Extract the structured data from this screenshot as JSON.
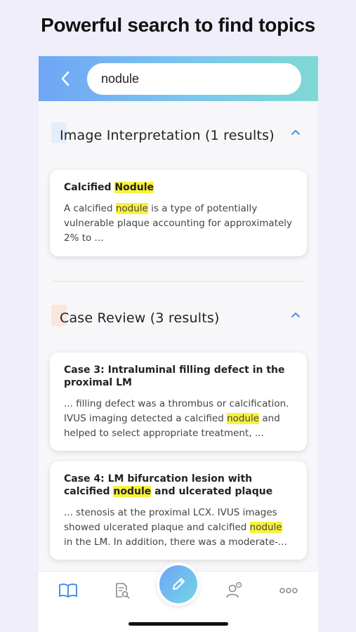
{
  "headline": "Powerful search to find topics",
  "search": {
    "value": "nodule"
  },
  "sections": [
    {
      "title": "Image Interpretation (1 results)",
      "icon": "document-icon",
      "icon_color": "#e4eefa",
      "results": [
        {
          "title_parts": [
            "Calcified ",
            "Nodule",
            ""
          ],
          "body_parts": [
            "A calcified ",
            "nodule",
            " is a type of potentially vulnerable plaque accounting for approximately 2% to ..."
          ]
        }
      ]
    },
    {
      "title": "Case Review (3 results)",
      "icon": "case-icon",
      "icon_color": "#fbe6dc",
      "results": [
        {
          "title_parts": [
            "Case 3: Intraluminal filling defect in the proximal LM",
            "",
            ""
          ],
          "body_parts": [
            "... filling defect was a thrombus or calcification. IVUS imaging detected a calcified ",
            "nodule",
            " and helped to select appropriate treatment, ..."
          ]
        },
        {
          "title_parts": [
            "Case 4: LM bifurcation lesion with calcified ",
            "nodule",
            " and ulcerated plaque"
          ],
          "body_parts": [
            "... stenosis at the proximal LCX. IVUS images showed ulcerated plaque and calcified ",
            "nodule",
            " in the LM. In addition, there was a moderate-..."
          ]
        }
      ]
    }
  ],
  "tabbar": {
    "items": [
      "book-icon",
      "search-document-icon",
      "edit-icon",
      "user-icon",
      "more-icon"
    ],
    "active": "book-icon"
  },
  "colors": {
    "accent": "#4a8fe6",
    "highlight": "#f9f23c",
    "gradient_start": "#6fa5f5",
    "gradient_end": "#7ed9d3",
    "background": "#f0eefb"
  }
}
